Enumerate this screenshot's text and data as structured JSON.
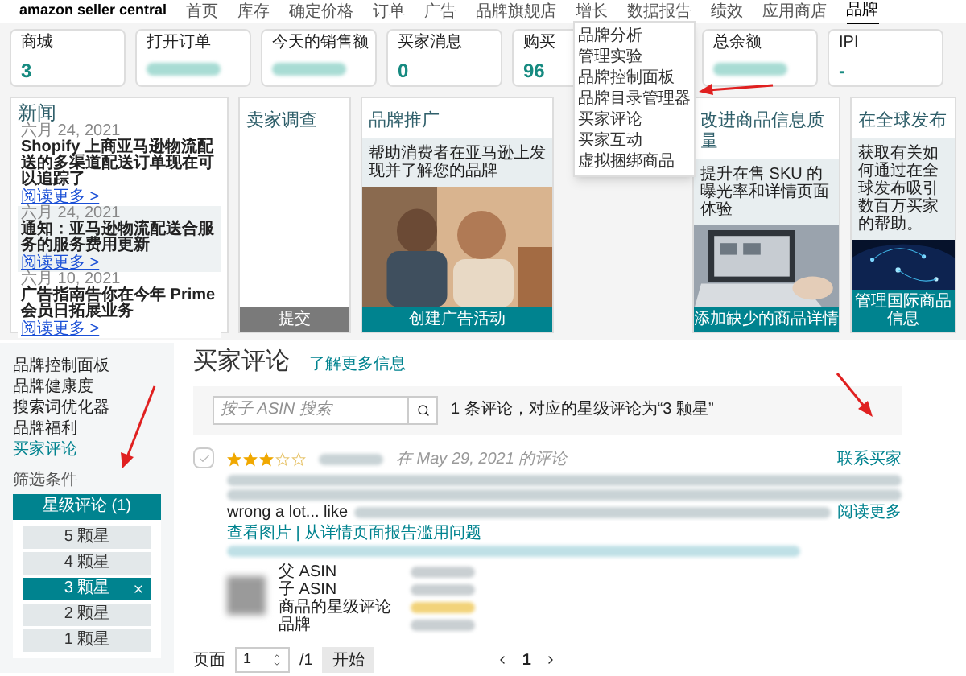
{
  "nav": {
    "logo": "amazon seller central",
    "items": [
      {
        "label": "首页",
        "selected": false
      },
      {
        "label": "库存",
        "selected": false
      },
      {
        "label": "确定价格",
        "selected": false
      },
      {
        "label": "订单",
        "selected": false
      },
      {
        "label": "广告",
        "selected": false
      },
      {
        "label": "品牌旗舰店",
        "selected": false
      },
      {
        "label": "增长",
        "selected": false
      },
      {
        "label": "数据报告",
        "selected": false
      },
      {
        "label": "绩效",
        "selected": false
      },
      {
        "label": "应用商店",
        "selected": false
      },
      {
        "label": "品牌",
        "selected": true
      }
    ]
  },
  "metrics": [
    {
      "label": "商城",
      "value": "3",
      "redacted": false
    },
    {
      "label": "打开订单",
      "redacted": true
    },
    {
      "label": "今天的销售额",
      "redacted": true
    },
    {
      "label": "买家消息",
      "value": "0",
      "redacted": false
    },
    {
      "label": "购买",
      "value": "96",
      "redacted": false
    },
    {
      "label": "总余额",
      "redacted": true
    },
    {
      "label": "IPI",
      "value": "-",
      "redacted": false
    }
  ],
  "brand_menu": {
    "items": [
      {
        "label": "品牌分析"
      },
      {
        "label": "管理实验"
      },
      {
        "label": "品牌控制面板"
      },
      {
        "label": "品牌目录管理器"
      },
      {
        "label": "买家评论"
      },
      {
        "label": "买家互动"
      },
      {
        "label": "虚拟捆绑商品"
      }
    ]
  },
  "news": {
    "title": "新闻",
    "items": [
      {
        "date": "六月 24, 2021",
        "title": "Shopify 上商亚马逊物流配送的多渠道配送订单现在可以追踪了",
        "link": "阅读更多 >",
        "highlighted": false
      },
      {
        "date": "六月 24, 2021",
        "title": "通知：亚马逊物流配送合服务的服务费用更新",
        "link": "阅读更多 >",
        "highlighted": true
      },
      {
        "date": "六月 10, 2021",
        "title": "广告指南告你在今年 Prime 会员日拓展业务",
        "link": "阅读更多 >",
        "highlighted": false
      }
    ]
  },
  "cards": [
    {
      "kind": "survey",
      "title": "卖家调查",
      "button": "提交"
    },
    {
      "kind": "promo",
      "title": "品牌推广",
      "description": "帮助消费者在亚马逊上发现并了解您的品牌",
      "button": "创建广告活动"
    },
    {
      "kind": "promo",
      "title": "改进商品信息质量",
      "description": "提升在售 SKU 的曝光率和详情页面体验",
      "button": "添加缺少的商品详情"
    },
    {
      "kind": "promo",
      "title": "在全球发布",
      "description": "获取有关如何通过在全球发布吸引数百万买家的帮助。",
      "button": "管理国际商品信息"
    }
  ],
  "sidebar": {
    "items": [
      {
        "label": "品牌控制面板",
        "selected": false
      },
      {
        "label": "品牌健康度",
        "selected": false
      },
      {
        "label": "搜索词优化器",
        "selected": false
      },
      {
        "label": "品牌福利",
        "selected": false
      },
      {
        "label": "买家评论",
        "selected": true
      }
    ],
    "filter_label": "筛选条件",
    "filter_button": "星级评论 (1)",
    "options": [
      {
        "label": "5 颗星",
        "selected": false
      },
      {
        "label": "4 颗星",
        "selected": false
      },
      {
        "label": "3 颗星",
        "selected": true
      },
      {
        "label": "2 颗星",
        "selected": false
      },
      {
        "label": "1 颗星",
        "selected": false
      }
    ]
  },
  "reviews": {
    "title": "买家评论",
    "learn_more": "了解更多信息",
    "search": {
      "placeholder": "按子 ASIN 搜索"
    },
    "summary": "1 条评论，对应的星级评论为“3 颗星”",
    "review": {
      "checked": false,
      "stars": 3,
      "date": "在 May 29, 2021 的评论",
      "contact": "联系买家",
      "snippet": "wrong a lot... like",
      "read_more": "阅读更多",
      "links": "查看图片 | 从详情页面报告滥用问题",
      "fields": [
        "父 ASIN",
        "子 ASIN",
        "商品的星级评论",
        "品牌"
      ]
    },
    "pagination": {
      "label": "页面",
      "page": "1",
      "total": "/1",
      "go": "开始",
      "pager": "1"
    }
  }
}
